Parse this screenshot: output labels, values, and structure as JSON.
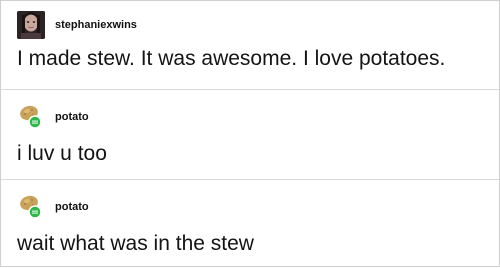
{
  "posts": [
    {
      "username": "stephaniexwins",
      "avatar_icon": "person-photo-avatar",
      "text": "I made stew. It was awesome. I love potatoes."
    },
    {
      "username": "potato",
      "avatar_icon": "potato-avatar-with-follow-badge",
      "text": "i luv u too"
    },
    {
      "username": "potato",
      "avatar_icon": "potato-avatar-with-follow-badge",
      "text": "wait what was in the stew"
    }
  ],
  "colors": {
    "badge_green": "#2fb84a",
    "potato_brown": "#c9a25a",
    "divider": "#d9d9d9",
    "text": "#141414"
  }
}
